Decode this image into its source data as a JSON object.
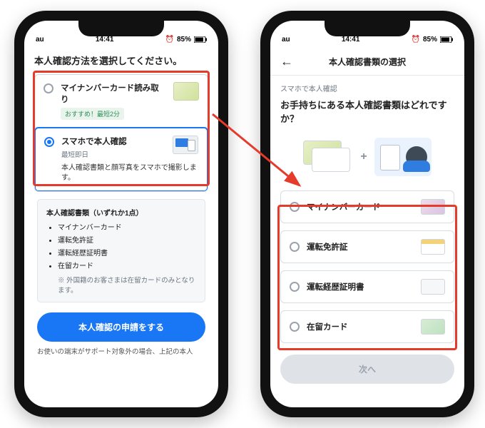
{
  "status": {
    "carrier": "au",
    "time": "14:41",
    "battery": "85%"
  },
  "left": {
    "heading": "本人確認方法を選択してください。",
    "options": [
      {
        "title": "マイナンバーカード読み取り",
        "badge": "おすすめ！最短2分",
        "selected": false
      },
      {
        "title": "スマホで本人確認",
        "subgrey": "最短即日",
        "desc": "本人確認書類と顔写真をスマホで撮影します。",
        "selected": true
      }
    ],
    "docs": {
      "title": "本人確認書類（いずれか1点）",
      "items": [
        "マイナンバーカード",
        "運転免許証",
        "運転経歴証明書",
        "在留カード"
      ],
      "note": "※ 外国籍のお客さまは在留カードのみとなります。"
    },
    "cta": "本人確認の申請をする",
    "footnote": "お使いの端末がサポート対象外の場合、上記の本人"
  },
  "right": {
    "nav_title": "本人確認書類の選択",
    "crumb": "スマホで本人確認",
    "heading": "お手持ちにある本人確認書類はどれですか？",
    "items": [
      "マイナンバーカード",
      "運転免許証",
      "運転経歴証明書",
      "在留カード"
    ],
    "next": "次へ"
  }
}
